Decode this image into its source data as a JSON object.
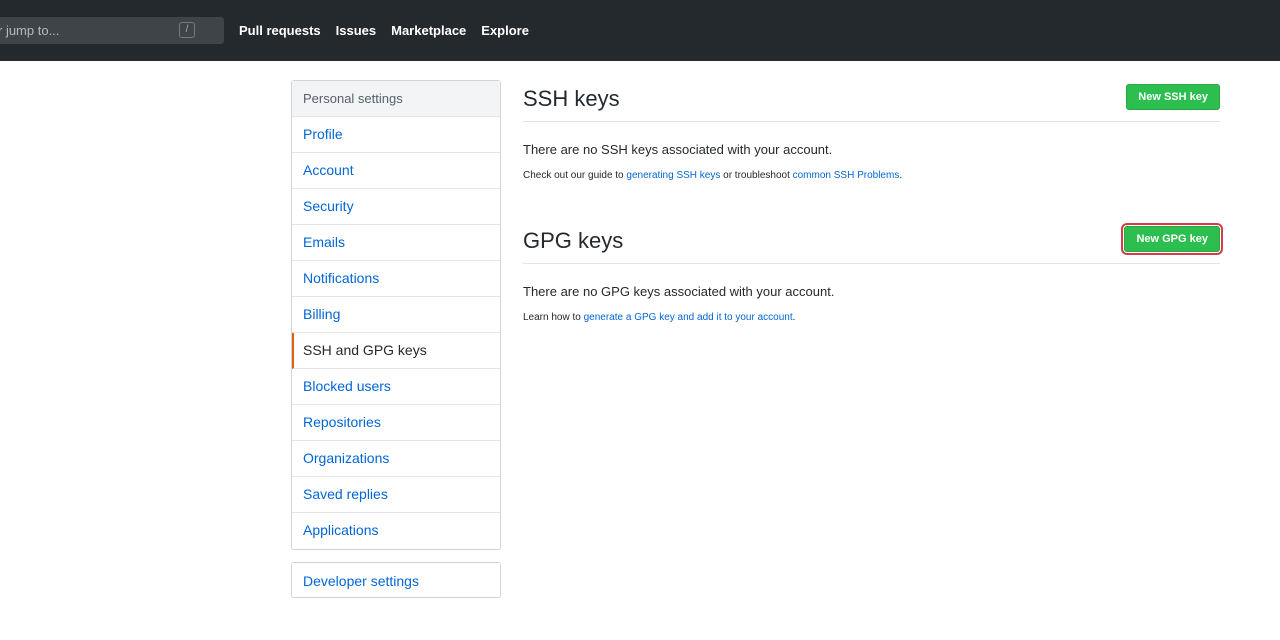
{
  "header": {
    "search_placeholder": "Search or jump to...",
    "search_visible": "r jump to...",
    "slash_key": "/",
    "nav": [
      "Pull requests",
      "Issues",
      "Marketplace",
      "Explore"
    ]
  },
  "sidebar": {
    "heading": "Personal settings",
    "items": [
      {
        "label": "Profile"
      },
      {
        "label": "Account"
      },
      {
        "label": "Security"
      },
      {
        "label": "Emails"
      },
      {
        "label": "Notifications"
      },
      {
        "label": "Billing"
      },
      {
        "label": "SSH and GPG keys"
      },
      {
        "label": "Blocked users"
      },
      {
        "label": "Repositories"
      },
      {
        "label": "Organizations"
      },
      {
        "label": "Saved replies"
      },
      {
        "label": "Applications"
      }
    ],
    "selected": "SSH and GPG keys",
    "developer": "Developer settings"
  },
  "ssh": {
    "title": "SSH keys",
    "button": "New SSH key",
    "blank": "There are no SSH keys associated with your account.",
    "note_prefix": "Check out our guide to ",
    "link1": "generating SSH keys",
    "note_middle": " or troubleshoot ",
    "link2": "common SSH Problems",
    "note_suffix": "."
  },
  "gpg": {
    "title": "GPG keys",
    "button": "New GPG key",
    "blank": "There are no GPG keys associated with your account.",
    "note_prefix": "Learn how to ",
    "link": "generate a GPG key and add it to your account",
    "note_suffix": "."
  },
  "colors": {
    "header_bg": "#24292e",
    "link": "#0366d6",
    "button_green": "#2cbe4e",
    "selected_accent": "#e36209",
    "highlight_outline": "#d73a49"
  }
}
